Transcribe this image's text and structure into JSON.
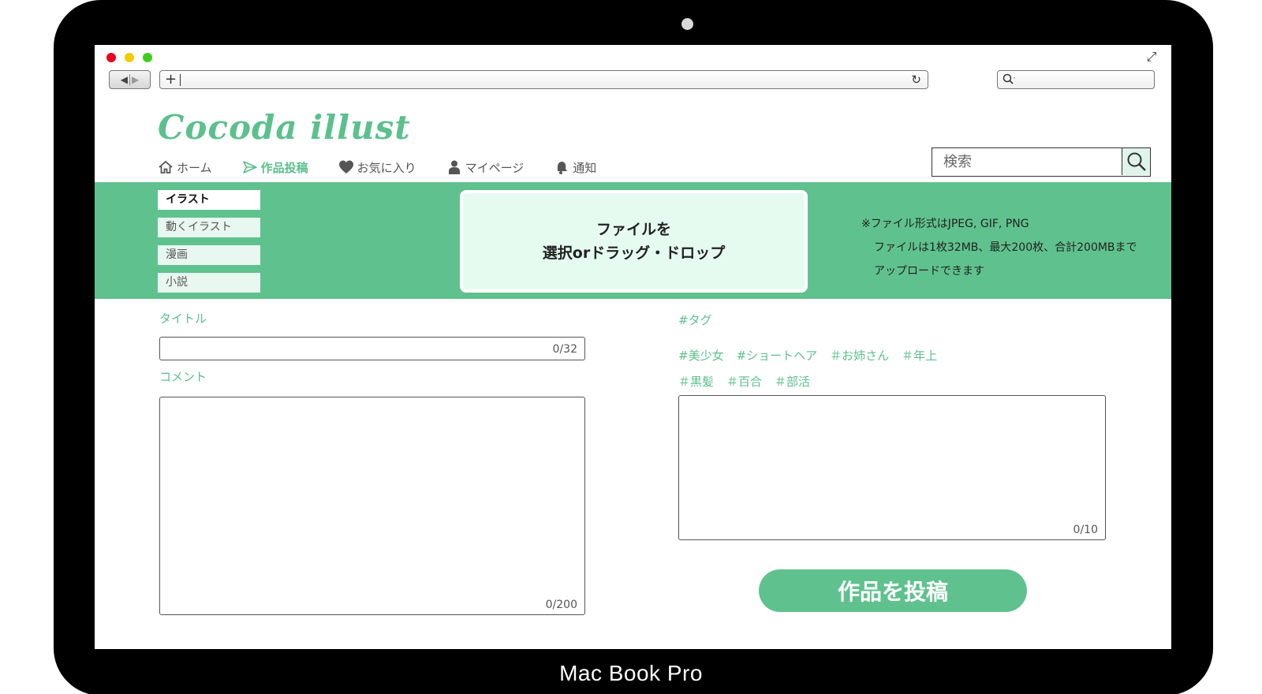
{
  "device": {
    "label": "Mac Book Pro"
  },
  "site": {
    "logo": "Cocoda illust"
  },
  "nav": {
    "items": [
      {
        "label": "ホーム",
        "icon": "home-icon"
      },
      {
        "label": "作品投稿",
        "icon": "send-icon",
        "active": true
      },
      {
        "label": "お気に入り",
        "icon": "heart-icon"
      },
      {
        "label": "マイページ",
        "icon": "person-icon"
      },
      {
        "label": "通知",
        "icon": "bell-icon"
      }
    ]
  },
  "search": {
    "placeholder": "検索"
  },
  "categories": [
    "イラスト",
    "動くイラスト",
    "漫画",
    "小説"
  ],
  "upload": {
    "drop_line1": "ファイルを",
    "drop_line2": "選択orドラッグ・ドロップ",
    "info_line1": "※ファイル形式はJPEG, GIF, PNG",
    "info_line2": "ファイルは1枚32MB、最大200枚、合計200MBまで",
    "info_line3": "アップロードできます"
  },
  "form": {
    "title_label": "タイトル",
    "title_counter": "0/32",
    "comment_label": "コメント",
    "comment_counter": "0/200",
    "tag_label": "#タグ",
    "tag_counter": "0/10",
    "suggested_tags_row1": [
      "#美少女",
      "#ショートヘア",
      "＃お姉さん",
      "＃年上"
    ],
    "suggested_tags_row2": [
      "＃黒髪",
      "＃百合",
      "＃部活"
    ],
    "submit_label": "作品を投稿"
  },
  "colors": {
    "accent": "#5fc28e",
    "frame": "#000000"
  }
}
